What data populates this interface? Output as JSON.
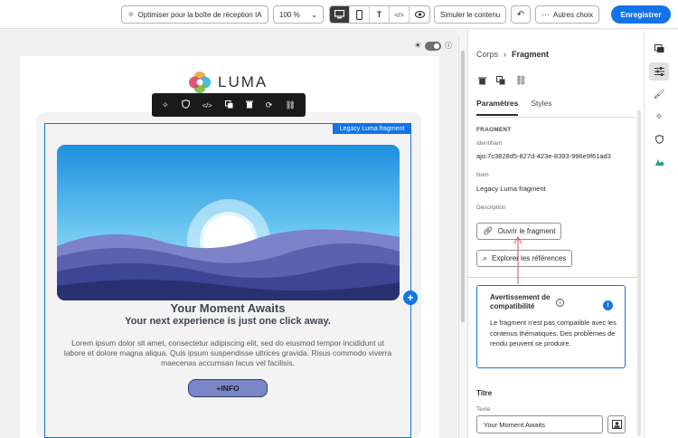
{
  "toolbar": {
    "optimize_label": "Optimiser pour la boîte de réception IA",
    "zoom": "100 %",
    "simulate_label": "Simuler le contenu",
    "other_choices_label": "Autres choix",
    "save_label": "Enregistrer"
  },
  "email": {
    "logo_text": "LUMA",
    "fragment_label": "Legacy Luma fragment",
    "headline": "Your Moment Awaits",
    "subheadline": "Your next experience is just one click away.",
    "body": "Lorem ipsum dolor sit amet, consectetur adipiscing elit, sed do eiusmod tempor incididunt ut labore et dolore magna aliqua. Quis ipsum suspendisse ultrices gravida. Risus commodo viverra maecenas accumsan lacus vel facilisis.",
    "button_label": "+INFO"
  },
  "panel": {
    "breadcrumb_parent": "Corps",
    "breadcrumb_current": "Fragment",
    "tabs": [
      "Paramètres",
      "Styles"
    ],
    "section_title": "FRAGMENT",
    "identifier_label": "Identifiant",
    "identifier_value": "ajo:7c3828d5-827d-423e-8393-996e9f61ad3",
    "name_label": "Nom",
    "name_value": "Legacy Luma fragment",
    "description_label": "Description",
    "open_fragment_label": "Ouvrir le fragment",
    "explore_refs_label": "Explorer les références",
    "warning_title": "Avertissement de compatibilité",
    "warning_body": "Le fragment n'est pas compatible avec les contenus thématiques. Des problèmes de rendu peuvent se produire.",
    "title_section": "Titre",
    "text_label": "Texte",
    "text_value": "Your Moment Awaits"
  },
  "colors": {
    "accent": "#1473e6",
    "button_fill": "#7c87c7"
  }
}
